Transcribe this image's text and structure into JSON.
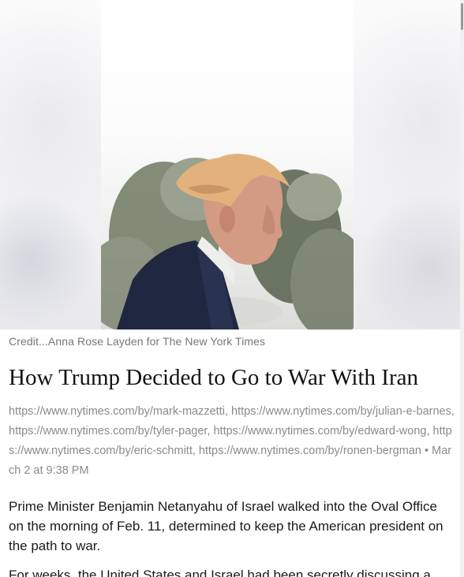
{
  "image": {
    "alt_icon": "portrait-photo"
  },
  "credit": "Credit...Anna Rose Layden for The New York Times",
  "headline": "How Trump Decided to Go to War With Iran",
  "byline": {
    "authors": "https://www.nytimes.com/by/mark-mazzetti, https://www.nytimes.com/by/julian-e-barnes, https://www.nytimes.com/by/tyler-pager, https://www.nytimes.com/by/edward-wong, https://www.nytimes.com/by/eric-schmitt, https://www.nytimes.com/by/ronen-bergman",
    "separator": "•",
    "date": "March 2 at 9:38 PM"
  },
  "paragraphs": [
    "Prime Minister Benjamin Netanyahu of Israel walked into the Oval Office on the morning of Feb. 11, determined to keep the American president on the path to war.",
    "For weeks, the United States and Israel had been secretly discussing a"
  ]
}
